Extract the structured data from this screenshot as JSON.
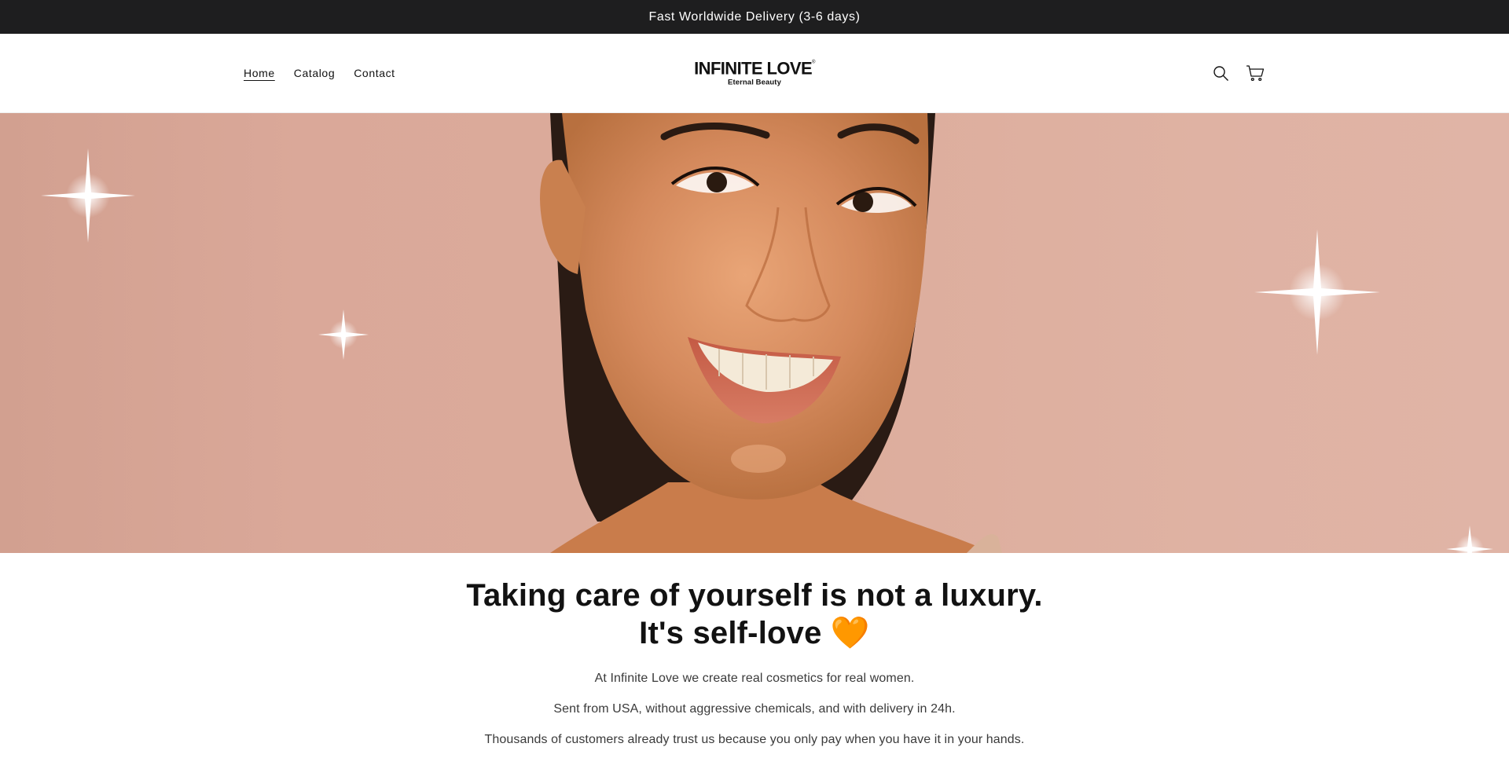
{
  "announcement": {
    "text": "Fast Worldwide Delivery (3-6 days)"
  },
  "nav": {
    "items": [
      {
        "label": "Home",
        "active": true
      },
      {
        "label": "Catalog",
        "active": false
      },
      {
        "label": "Contact",
        "active": false
      }
    ]
  },
  "logo": {
    "main": "INFINITE LOVE",
    "mark": "®",
    "tagline": "Eternal Beauty"
  },
  "icons": {
    "search": "search-icon",
    "cart": "cart-icon"
  },
  "hero": {
    "image": "smiling-woman-portrait-with-sparkles",
    "background": "#dcac9b"
  },
  "content": {
    "headline_line1": "Taking care of yourself is not a luxury.",
    "headline_line2": "It's self-love 🧡",
    "paragraphs": [
      "At Infinite Love we create real cosmetics for real women.",
      "Sent from USA, without aggressive chemicals, and with delivery in 24h.",
      "Thousands of customers already trust us because you only pay when you have it in your hands."
    ]
  }
}
